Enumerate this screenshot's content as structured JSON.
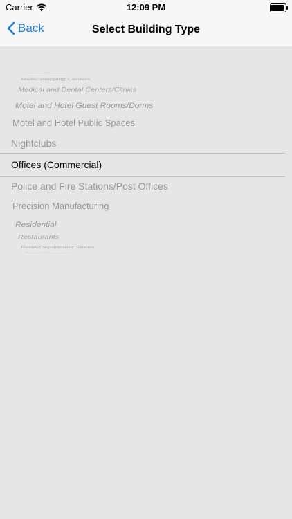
{
  "status_bar": {
    "carrier": "Carrier",
    "time": "12:09 PM"
  },
  "nav": {
    "back_label": "Back",
    "title": "Select Building Type"
  },
  "picker": {
    "selected": "Offices (Commercial)",
    "items": [
      "Libraries/Museums",
      "Malls/Shopping Centers",
      "Medical and Dental Centers/Clinics",
      "Motel and Hotel Guest Rooms/Dorms",
      "Motel and Hotel Public Spaces",
      "Nightclubs",
      "Offices (Commercial)",
      "Police and Fire Stations/Post Offices",
      "Precision Manufacturing",
      "Residential",
      "Restaurants",
      "Retail/Department Stores",
      "Schools/Classrooms"
    ]
  },
  "colors": {
    "accent": "#1a7ef5",
    "background": "#e6e6e6",
    "selected_text": "#000000",
    "unselected_text": "#999999"
  }
}
